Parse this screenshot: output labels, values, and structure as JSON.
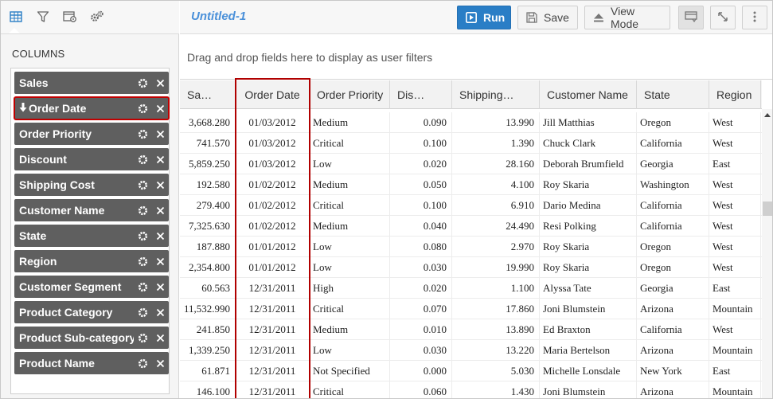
{
  "document": {
    "title": "Untitled-1"
  },
  "toolbar": {
    "run_label": "Run",
    "save_label": "Save",
    "view_mode_label": "View Mode"
  },
  "left_panel": {
    "section_title": "COLUMNS",
    "columns": [
      {
        "label": "Sales"
      },
      {
        "label": "Order Date",
        "selected": true
      },
      {
        "label": "Order Priority"
      },
      {
        "label": "Discount"
      },
      {
        "label": "Shipping Cost"
      },
      {
        "label": "Customer Name"
      },
      {
        "label": "State"
      },
      {
        "label": "Region"
      },
      {
        "label": "Customer Segment"
      },
      {
        "label": "Product Category"
      },
      {
        "label": "Product Sub-category"
      },
      {
        "label": "Product Name"
      }
    ]
  },
  "filter_zone": {
    "hint": "Drag and drop fields here to display as user filters"
  },
  "grid": {
    "headers": [
      "Sa…",
      "Order Date",
      "Order Priority",
      "Dis…",
      "Shipping…",
      "Customer Name",
      "State",
      "Region",
      "C"
    ],
    "rows": [
      [
        "3,668.280",
        "01/03/2012",
        "Medium",
        "0.090",
        "13.990",
        "Jill Matthias",
        "Oregon",
        "West"
      ],
      [
        "741.570",
        "01/03/2012",
        "Critical",
        "0.100",
        "1.390",
        "Chuck Clark",
        "California",
        "West"
      ],
      [
        "5,859.250",
        "01/03/2012",
        "Low",
        "0.020",
        "28.160",
        "Deborah Brumfield",
        "Georgia",
        "East"
      ],
      [
        "192.580",
        "01/02/2012",
        "Medium",
        "0.050",
        "4.100",
        "Roy Skaria",
        "Washington",
        "West"
      ],
      [
        "279.400",
        "01/02/2012",
        "Critical",
        "0.100",
        "6.910",
        "Dario Medina",
        "California",
        "West"
      ],
      [
        "7,325.630",
        "01/02/2012",
        "Medium",
        "0.040",
        "24.490",
        "Resi Polking",
        "California",
        "West"
      ],
      [
        "187.880",
        "01/01/2012",
        "Low",
        "0.080",
        "2.970",
        "Roy Skaria",
        "Oregon",
        "West"
      ],
      [
        "2,354.800",
        "01/01/2012",
        "Low",
        "0.030",
        "19.990",
        "Roy Skaria",
        "Oregon",
        "West"
      ],
      [
        "60.563",
        "12/31/2011",
        "High",
        "0.020",
        "1.100",
        "Alyssa Tate",
        "Georgia",
        "East"
      ],
      [
        "11,532.990",
        "12/31/2011",
        "Critical",
        "0.070",
        "17.860",
        "Joni Blumstein",
        "Arizona",
        "Mountain"
      ],
      [
        "241.850",
        "12/31/2011",
        "Medium",
        "0.010",
        "13.890",
        "Ed Braxton",
        "California",
        "West"
      ],
      [
        "1,339.250",
        "12/31/2011",
        "Low",
        "0.030",
        "13.220",
        "Maria Bertelson",
        "Arizona",
        "Mountain"
      ],
      [
        "61.871",
        "12/31/2011",
        "Not Specified",
        "0.000",
        "5.030",
        "Michelle Lonsdale",
        "New York",
        "East"
      ],
      [
        "146.100",
        "12/31/2011",
        "Critical",
        "0.060",
        "1.430",
        "Joni Blumstein",
        "Arizona",
        "Mountain"
      ]
    ]
  },
  "colors": {
    "accent_blue": "#2a7ec6",
    "title_blue": "#4a90d9",
    "column_item_bg": "#5f5f5f",
    "selection_red": "#b00000"
  },
  "icons": {
    "left_toolbar": [
      "table-icon",
      "filter-icon",
      "chart-settings-icon",
      "gears-icon"
    ],
    "column_item": [
      "gear-icon",
      "close-icon"
    ],
    "top_toolbar": [
      "play-icon",
      "save-icon",
      "eject-icon",
      "panel-icon",
      "expand-icon",
      "more-vertical-icon"
    ]
  }
}
